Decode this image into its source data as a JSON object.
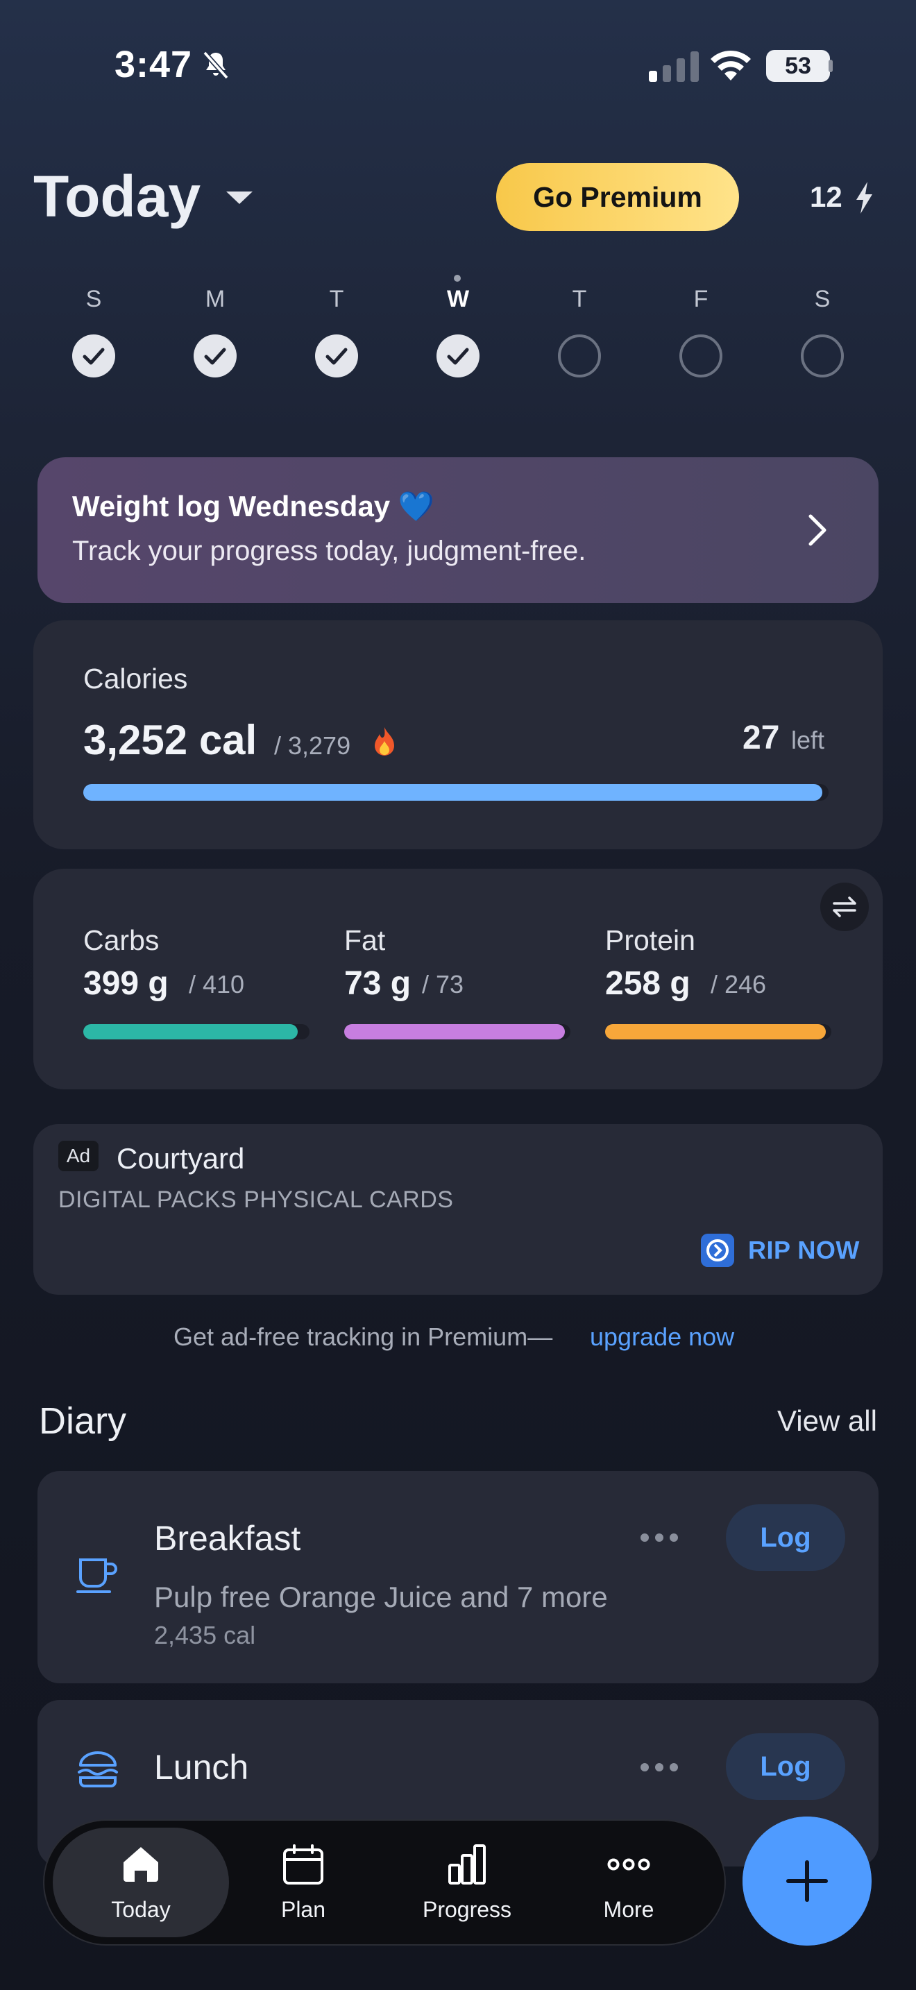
{
  "status_bar": {
    "time": "3:47",
    "battery": "53"
  },
  "header": {
    "title": "Today",
    "premium_label": "Go Premium",
    "streak": "12"
  },
  "week": {
    "days": [
      {
        "label": "S",
        "done": true
      },
      {
        "label": "M",
        "done": true
      },
      {
        "label": "T",
        "done": true
      },
      {
        "label": "W",
        "done": true,
        "current": true
      },
      {
        "label": "T",
        "done": false
      },
      {
        "label": "F",
        "done": false
      },
      {
        "label": "S",
        "done": false
      }
    ]
  },
  "banner": {
    "title": "Weight log Wednesday 💙",
    "subtitle": "Track your progress today, judgment-free."
  },
  "calories": {
    "label": "Calories",
    "value": "3,252 cal",
    "goal": "/ 3,279",
    "left_value": "27",
    "left_label": "left",
    "progress": 0.992,
    "bar_color": "#6fb3ff"
  },
  "macros": [
    {
      "label": "Carbs",
      "value": "399 g",
      "goal": "/ 410",
      "progress": 0.973,
      "color": "#2cb7a6"
    },
    {
      "label": "Fat",
      "value": "73 g",
      "goal": "/ 73",
      "progress": 1.0,
      "color": "#c77ee0"
    },
    {
      "label": "Protein",
      "value": "258 g",
      "goal": "/ 246",
      "progress": 1.0,
      "color": "#f7a73a"
    }
  ],
  "ad": {
    "tag": "Ad",
    "name": "Courtyard",
    "description": "DIGITAL PACKS PHYSICAL CARDS",
    "cta": "RIP NOW"
  },
  "upsell": {
    "text": "Get ad-free tracking in Premium—",
    "link": "upgrade now"
  },
  "diary": {
    "title": "Diary",
    "view_all": "View all",
    "meals": [
      {
        "name": "Breakfast",
        "items": "Pulp free Orange Juice and 7 more",
        "calories": "2,435 cal",
        "log_label": "Log",
        "icon": "coffee-cup-icon"
      },
      {
        "name": "Lunch",
        "log_label": "Log",
        "icon": "burger-icon"
      }
    ]
  },
  "nav": {
    "items": [
      {
        "label": "Today",
        "icon": "home-icon",
        "active": true
      },
      {
        "label": "Plan",
        "icon": "calendar-icon"
      },
      {
        "label": "Progress",
        "icon": "bar-chart-icon"
      },
      {
        "label": "More",
        "icon": "more-dots-icon"
      }
    ]
  },
  "colors": {
    "accent": "#4f9bff",
    "premium": "#f8c84a"
  }
}
